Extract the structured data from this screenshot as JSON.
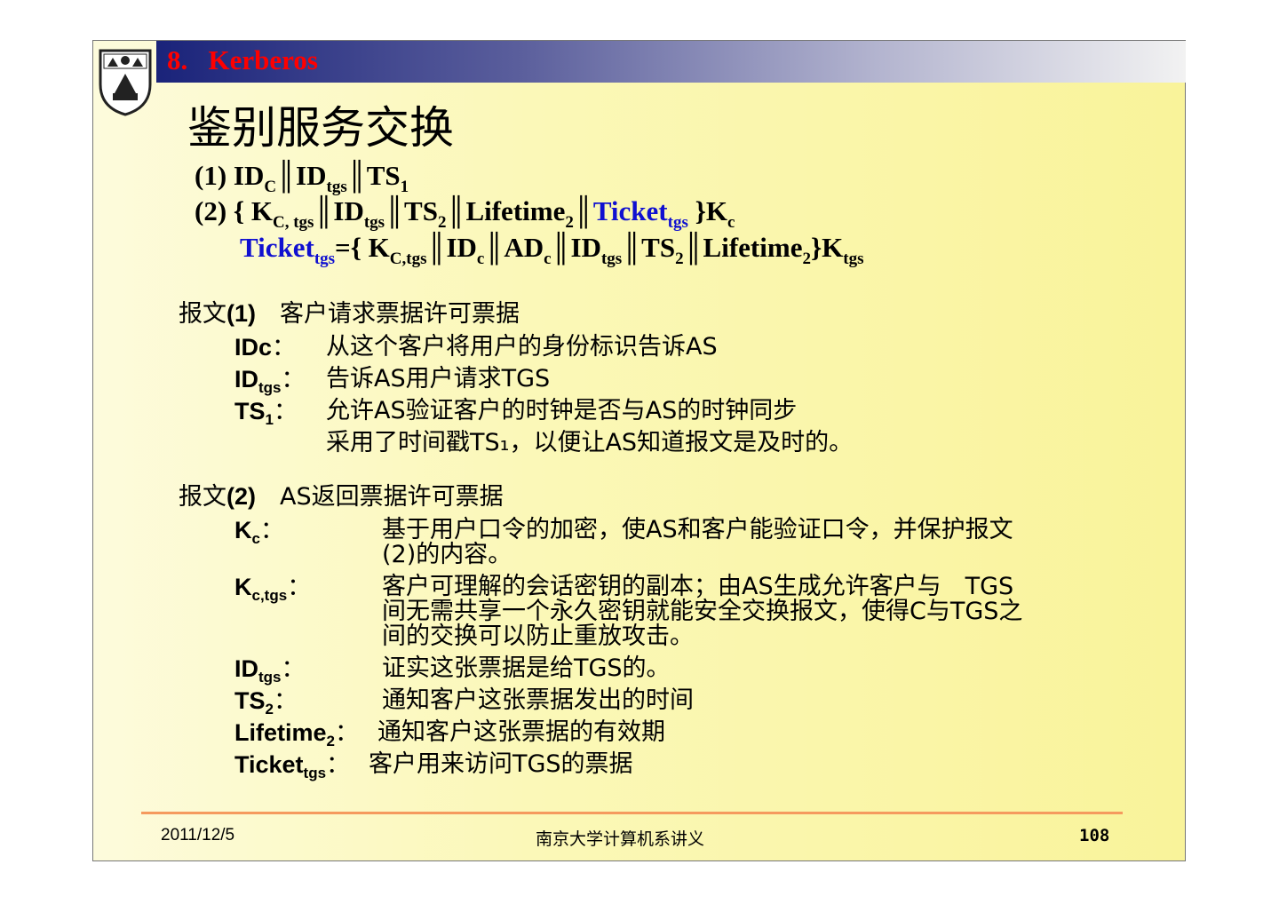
{
  "header": {
    "section": "8.   Kerberos",
    "title": "鉴别服务交换"
  },
  "formula": {
    "line1": [
      {
        "t": "(1)  ID"
      },
      {
        "s": "C"
      },
      {
        "t": "║ID"
      },
      {
        "s": "tgs"
      },
      {
        "t": "║TS"
      },
      {
        "s": "1"
      }
    ],
    "line2": [
      {
        "t": "(2)  { K"
      },
      {
        "s": "C, tgs"
      },
      {
        "t": "║ID"
      },
      {
        "s": "tgs"
      },
      {
        "t": "║TS"
      },
      {
        "s": "2"
      },
      {
        "t": "║Lifetime"
      },
      {
        "s": "2"
      },
      {
        "t": "║"
      },
      {
        "t": "Ticket",
        "blue": true
      },
      {
        "s": "tgs",
        "blue": true
      },
      {
        "t": " }K"
      },
      {
        "s": "c"
      }
    ],
    "line3": [
      {
        "t": "Ticket",
        "blue": true
      },
      {
        "s": "tgs",
        "blue": true
      },
      {
        "t": "={ K"
      },
      {
        "s": "C,tgs"
      },
      {
        "t": "║ID"
      },
      {
        "s": "c"
      },
      {
        "t": "║AD"
      },
      {
        "s": "c"
      },
      {
        "t": "║ID"
      },
      {
        "s": "tgs"
      },
      {
        "t": "║TS"
      },
      {
        "s": "2"
      },
      {
        "t": "║Lifetime"
      },
      {
        "s": "2"
      },
      {
        "t": "}K"
      },
      {
        "s": "tgs"
      }
    ]
  },
  "msg1": {
    "heading": [
      "报文",
      "(1)",
      "　客户请求票据许可票据"
    ],
    "items": [
      {
        "k": "IDc",
        "sub": "",
        "sep": "：",
        "text": "从这个客户将用户的身份标识告诉AS"
      },
      {
        "k": "ID",
        "sub": "tgs",
        "sep": "：",
        "text": "告诉AS用户请求TGS"
      },
      {
        "k": "TS",
        "sub": "1",
        "sep": "：",
        "text": "允许AS验证客户的时钟是否与AS的时钟同步"
      }
    ],
    "extra": "采用了时间戳TS₁，以便让AS知道报文是及时的。"
  },
  "msg2": {
    "heading": [
      "报文",
      "(2)",
      "　AS返回票据许可票据"
    ],
    "items": [
      {
        "k": "K",
        "sub": "c",
        "sep": "：",
        "lines": [
          "基于用户口令的加密，使AS和客户能验证口令，并保护报文",
          "(2)的内容。"
        ]
      },
      {
        "k": "K",
        "sub": "c,tgs",
        "sep": "：",
        "lines": [
          "客户可理解的会话密钥的副本；由AS生成允许客户与　TGS",
          "间无需共享一个永久密钥就能安全交换报文，使得C与TGS之",
          "间的交换可以防止重放攻击。"
        ]
      },
      {
        "k": "ID",
        "sub": "tgs",
        "sep": "：",
        "lines": [
          "证实这张票据是给TGS的。"
        ]
      },
      {
        "k": "TS",
        "sub": "2",
        "sep": "：",
        "lines": [
          "通知客户这张票据发出的时间"
        ]
      },
      {
        "k": "Lifetime",
        "sub": "2",
        "sep": "：",
        "lines": [
          "通知客户这张票据的有效期"
        ]
      },
      {
        "k": "Ticket",
        "sub": "tgs",
        "sep": "：",
        "lines": [
          "客户用来访问TGS的票据"
        ]
      }
    ]
  },
  "footer": {
    "date": "2011/12/5",
    "center": "南京大学计算机系讲义",
    "page": "108"
  }
}
